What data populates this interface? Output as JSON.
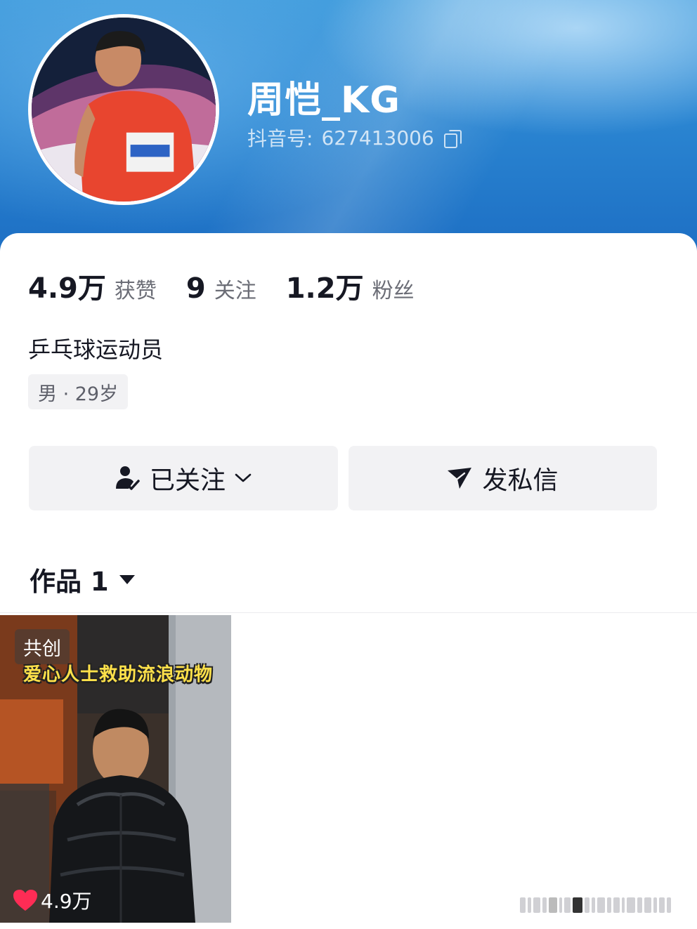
{
  "profile": {
    "username": "周恺_KG",
    "douyin_id_label": "抖音号:",
    "douyin_id": "627413006",
    "bio": "乒乓球运动员",
    "tag": "男 · 29岁"
  },
  "stats": [
    {
      "value": "4.9万",
      "label": "获赞"
    },
    {
      "value": "9",
      "label": "关注"
    },
    {
      "value": "1.2万",
      "label": "粉丝"
    }
  ],
  "actions": {
    "follow_label": "已关注",
    "message_label": "发私信"
  },
  "works": {
    "title": "作品 1"
  },
  "video": {
    "cocreate_label": "共创",
    "caption": "爱心人士救助流浪动物",
    "likes": "4.9万"
  },
  "colors": {
    "banner": "#2b86d2",
    "heart": "#fe2c55",
    "caption": "#ffe14a"
  }
}
